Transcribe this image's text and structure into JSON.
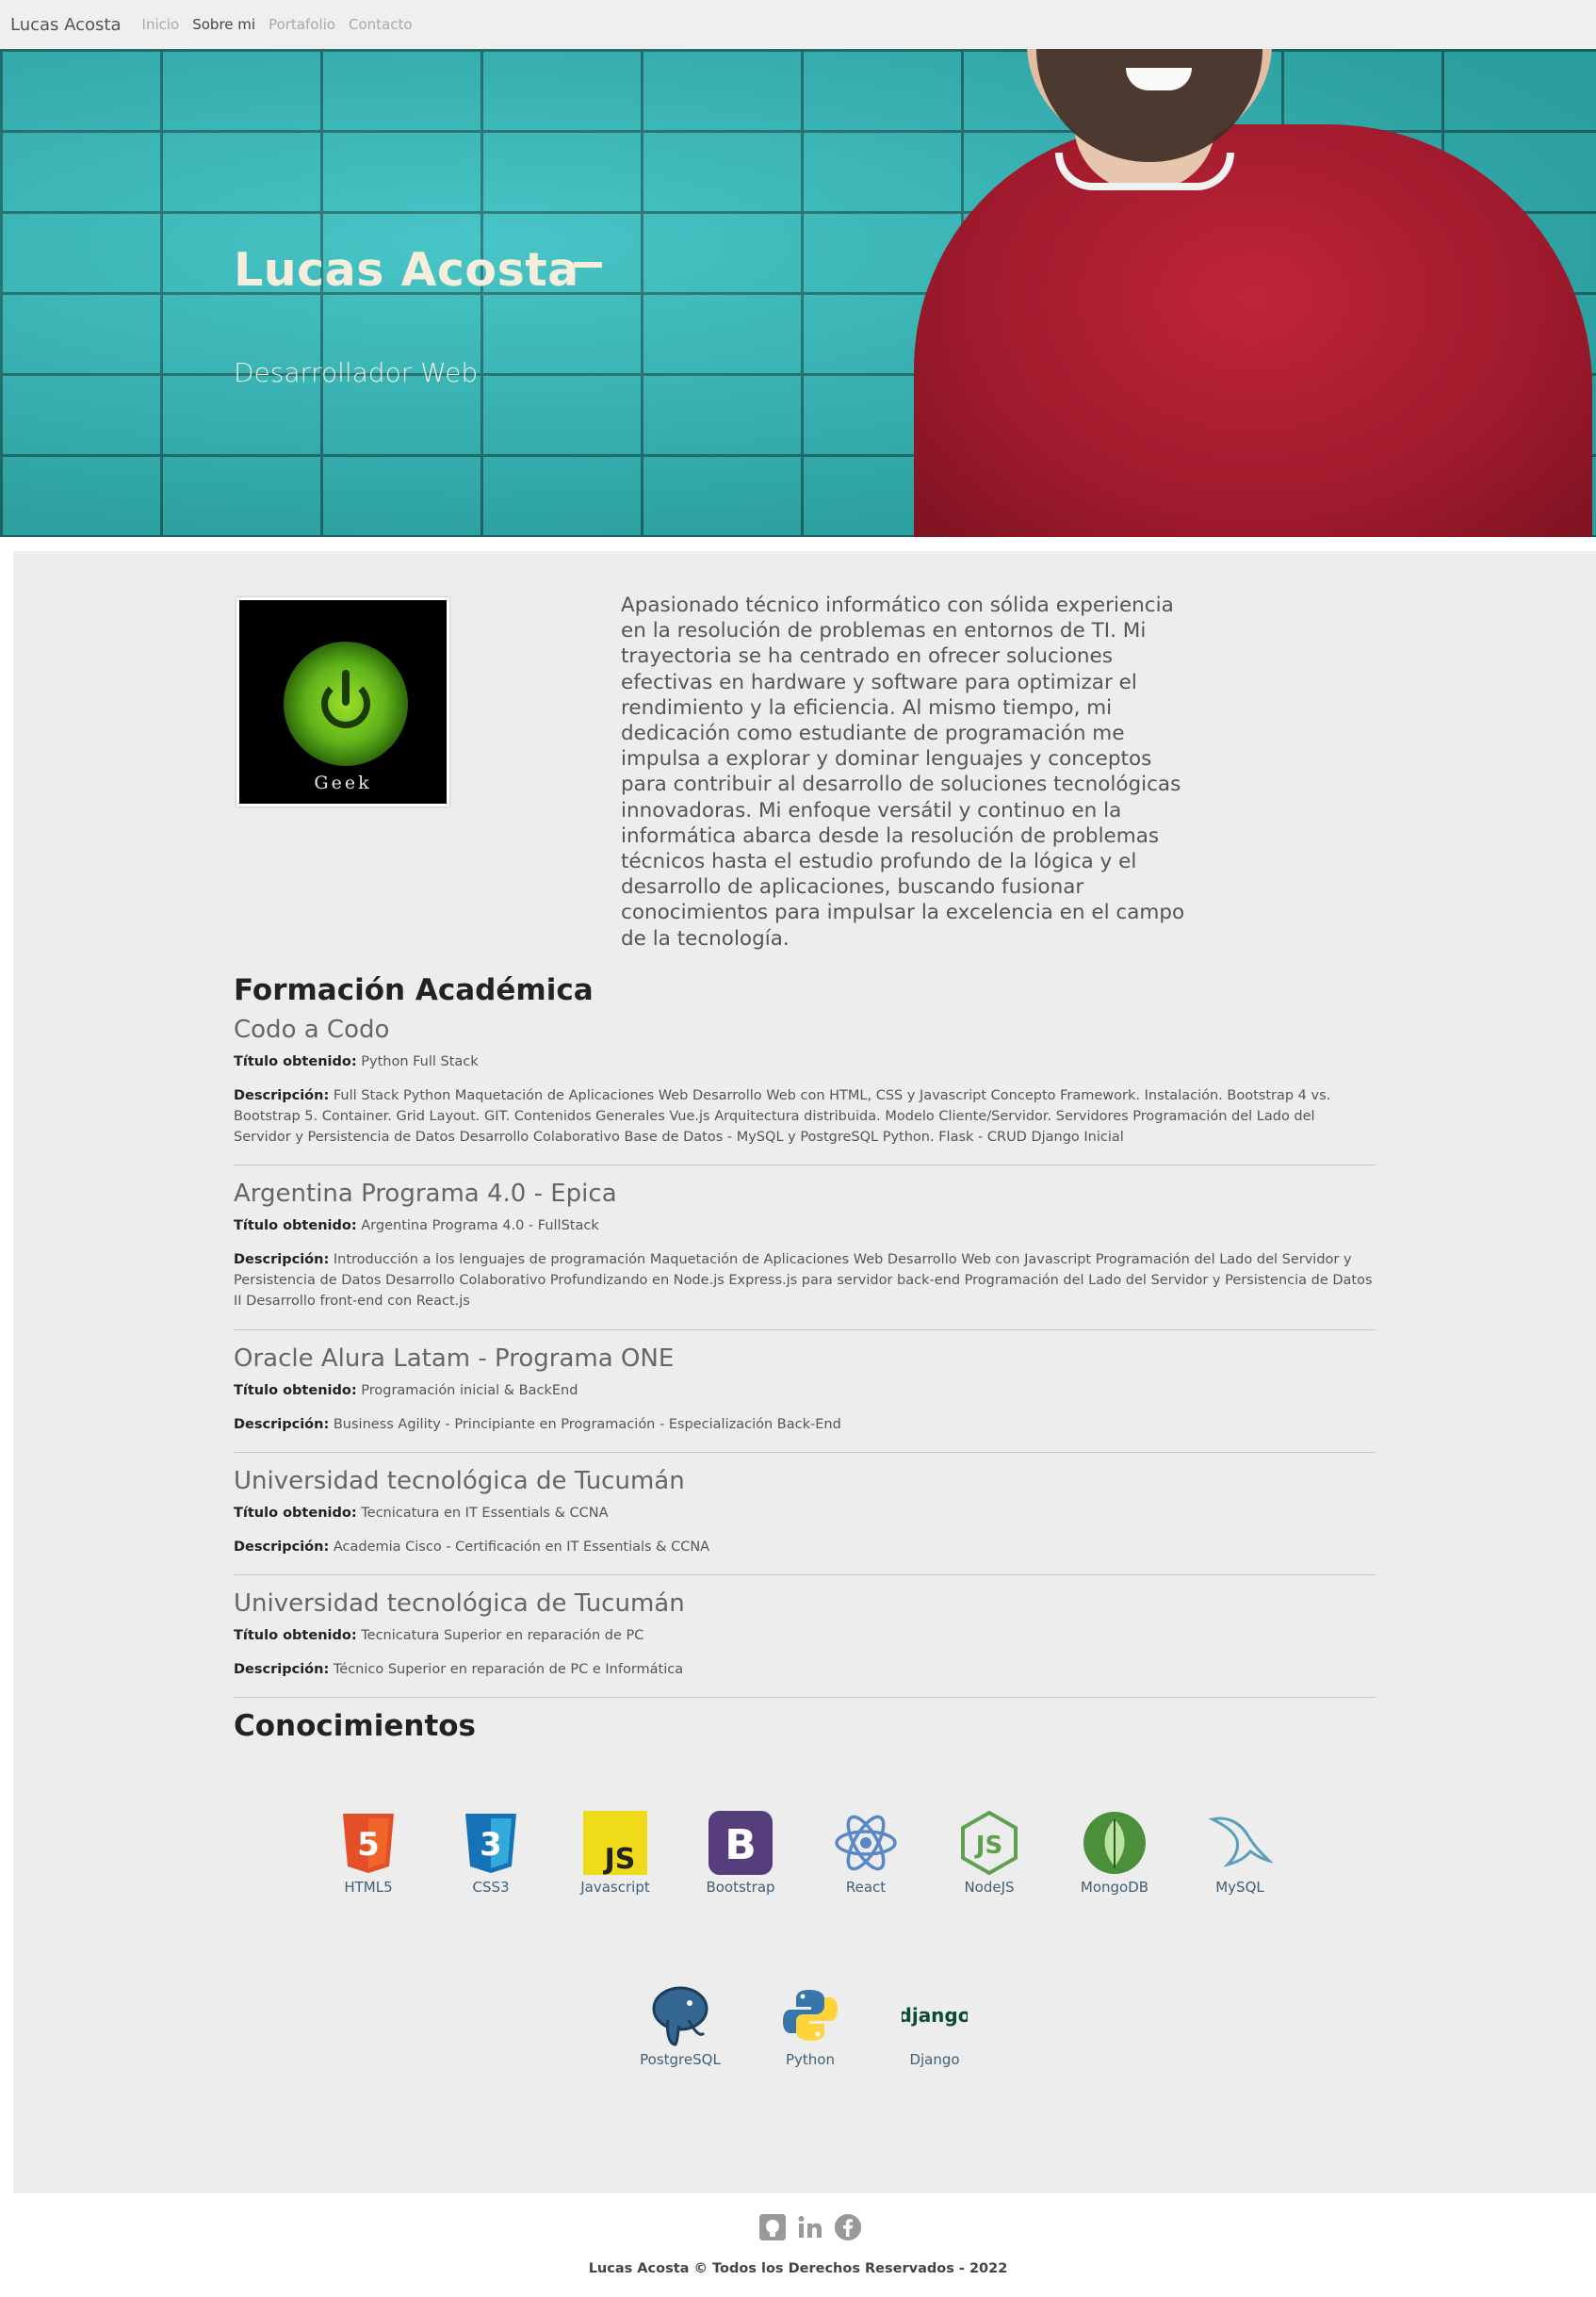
{
  "navbar": {
    "brand": "Lucas Acosta",
    "items": [
      {
        "label": "Inicio"
      },
      {
        "label": "Sobre mi",
        "active": true
      },
      {
        "label": "Portafolio"
      },
      {
        "label": "Contacto"
      }
    ]
  },
  "hero": {
    "title": "Lucas Acosta",
    "subtitle": "Desarrollador Web"
  },
  "profile": {
    "image_label": "Geek",
    "about": "Apasionado técnico informático con sólida experiencia en la resolución de problemas en entornos de TI. Mi trayectoria se ha centrado en ofrecer soluciones efectivas en hardware y software para optimizar el rendimiento y la eficiencia. Al mismo tiempo, mi dedicación como estudiante de programación me impulsa a explorar y dominar lenguajes y conceptos para contribuir al desarrollo de soluciones tecnológicas innovadoras. Mi enfoque versátil y continuo en la informática abarca desde la resolución de problemas técnicos hasta el estudio profundo de la lógica y el desarrollo de aplicaciones, buscando fusionar conocimientos para impulsar la excelencia en el campo de la tecnología."
  },
  "education": {
    "title": "Formación Académica",
    "title_label": "Título obtenido:",
    "desc_label": "Descripción:",
    "items": [
      {
        "institution": "Codo a Codo",
        "degree": "Python Full Stack",
        "description": "Full Stack Python Maquetación de Aplicaciones Web Desarrollo Web con HTML, CSS y Javascript Concepto Framework. Instalación. Bootstrap 4 vs. Bootstrap 5. Container. Grid Layout. GIT. Contenidos Generales Vue.js Arquitectura distribuida. Modelo Cliente/Servidor. Servidores Programación del Lado del Servidor y Persistencia de Datos Desarrollo Colaborativo Base de Datos - MySQL y PostgreSQL Python. Flask - CRUD Django Inicial"
      },
      {
        "institution": "Argentina Programa 4.0 - Epica",
        "degree": "Argentina Programa 4.0 - FullStack",
        "description": "Introducción a los lenguajes de programación Maquetación de Aplicaciones Web Desarrollo Web con Javascript Programación del Lado del Servidor y Persistencia de Datos Desarrollo Colaborativo Profundizando en Node.js Express.js para servidor back-end Programación del Lado del Servidor y Persistencia de Datos II Desarrollo front-end con React.js"
      },
      {
        "institution": "Oracle Alura Latam - Programa ONE",
        "degree": "Programación inicial & BackEnd",
        "description": "Business Agility - Principiante en Programación - Especialización Back-End"
      },
      {
        "institution": "Universidad tecnológica de Tucumán",
        "degree": "Tecnicatura en IT Essentials & CCNA",
        "description": "Academia Cisco - Certificación en IT Essentials & CCNA"
      },
      {
        "institution": "Universidad tecnológica de Tucumán",
        "degree": "Tecnicatura Superior en reparación de PC",
        "description": "Técnico Superior en reparación de PC e Informática"
      }
    ]
  },
  "skills": {
    "title": "Conocimientos",
    "items": [
      {
        "label": "HTML5",
        "icon": "html5-icon",
        "color": "#e34f26"
      },
      {
        "label": "CSS3",
        "icon": "css3-icon",
        "color": "#2965f1"
      },
      {
        "label": "Javascript",
        "icon": "javascript-icon",
        "color": "#f0db1a"
      },
      {
        "label": "Bootstrap",
        "icon": "bootstrap-icon",
        "color": "#563d7c"
      },
      {
        "label": "React",
        "icon": "react-icon",
        "color": "#5a88c6"
      },
      {
        "label": "NodeJS",
        "icon": "nodejs-icon",
        "color": "#5fa04e"
      },
      {
        "label": "MongoDB",
        "icon": "mongodb-icon",
        "color": "#4b8f3a"
      },
      {
        "label": "MySQL",
        "icon": "mysql-icon",
        "color": "#5b9fb8"
      },
      {
        "label": "PostgreSQL",
        "icon": "postgresql-icon",
        "color": "#336791"
      },
      {
        "label": "Python",
        "icon": "python-icon",
        "color": "#3776ab"
      },
      {
        "label": "Django",
        "icon": "django-icon",
        "color": "#0c4b33"
      }
    ]
  },
  "footer": {
    "icons": [
      "github-icon",
      "linkedin-icon",
      "facebook-icon"
    ],
    "copyright": "Lucas Acosta © Todos los Derechos Reservados - 2022"
  }
}
